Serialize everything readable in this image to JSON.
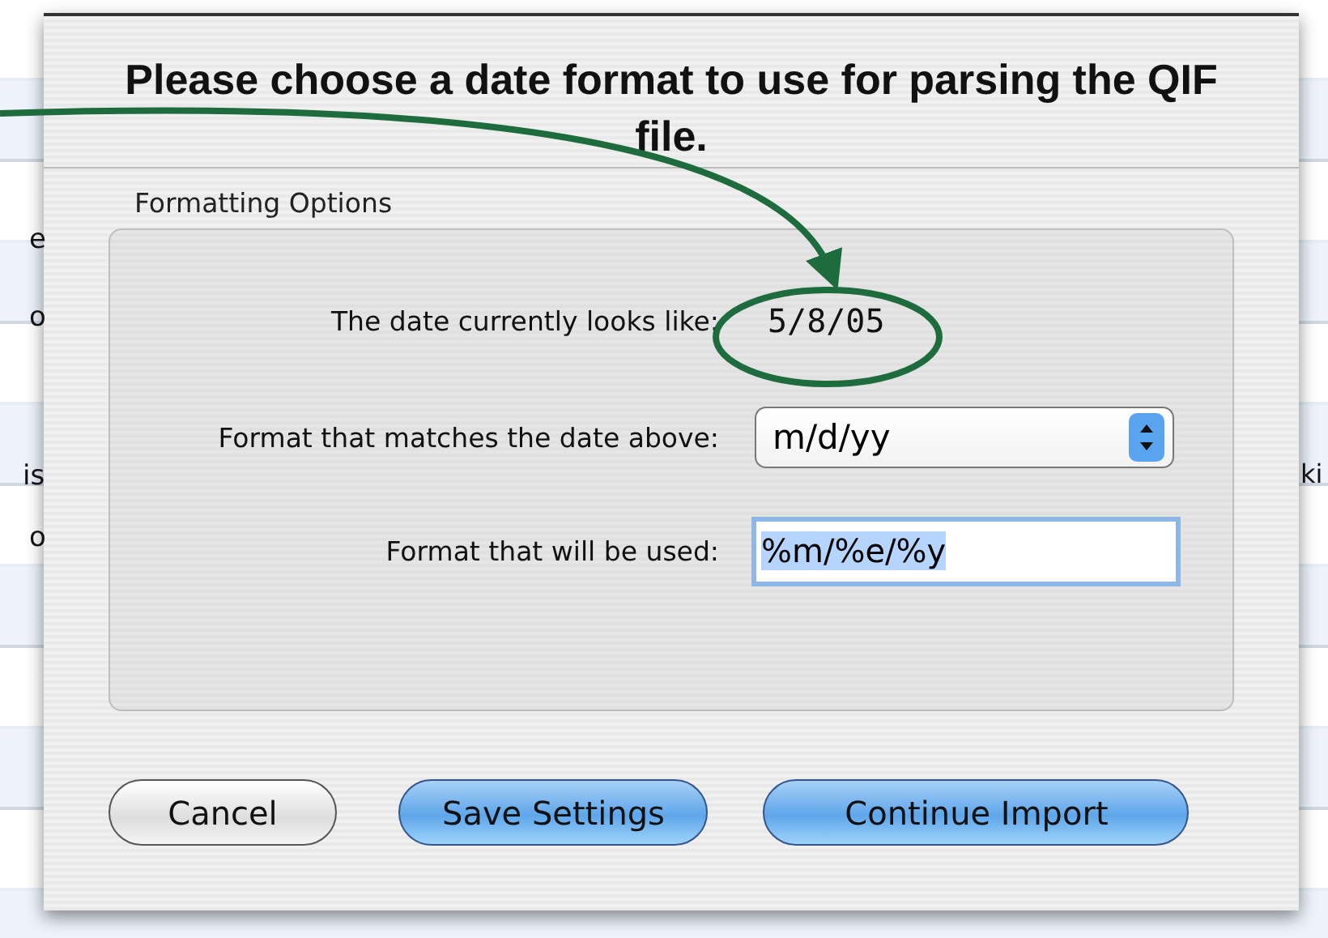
{
  "background_table": {
    "left_cells": [
      "e",
      "o",
      "is",
      "o"
    ],
    "right_cells": [
      "ki"
    ]
  },
  "dialog": {
    "title": "Please choose a date format to use for parsing the QIF file.",
    "group_label": "Formatting Options",
    "current_date": {
      "label": "The date currently looks like:",
      "value": "5/8/05"
    },
    "format_popup": {
      "label": "Format that matches the date above:",
      "value": "m/d/yy"
    },
    "format_field": {
      "label": "Format that will be used:",
      "value": "%m/%e/%y",
      "selected": true
    },
    "buttons": [
      {
        "label": "Cancel",
        "kind": "plain"
      },
      {
        "label": "Save Settings",
        "kind": "primary"
      },
      {
        "label": "Continue Import",
        "kind": "primary"
      }
    ]
  }
}
